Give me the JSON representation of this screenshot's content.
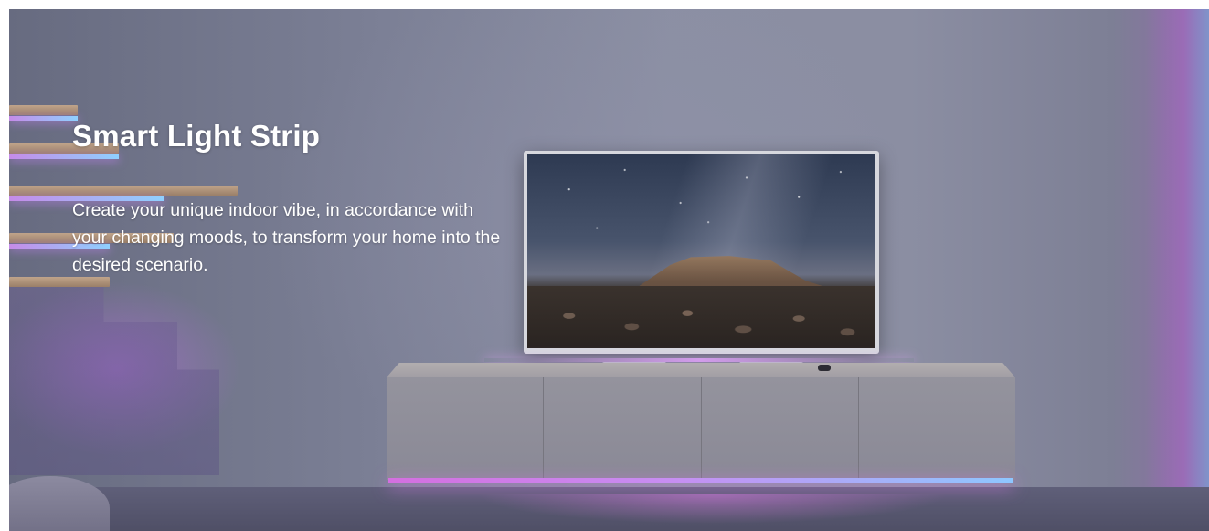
{
  "hero": {
    "title": "Smart Light Strip",
    "description": "Create your unique indoor vibe, in accordance with your changing moods, to transform your home into the desired scenario."
  },
  "colors": {
    "text": "#ffffff",
    "wall": "#8b8fa3",
    "led_purple": "#c78ef2",
    "led_blue": "#8ec7ff"
  },
  "scene": {
    "description_items": [
      "tv",
      "tv-console",
      "staircase",
      "led-light-strip",
      "pouf"
    ]
  }
}
